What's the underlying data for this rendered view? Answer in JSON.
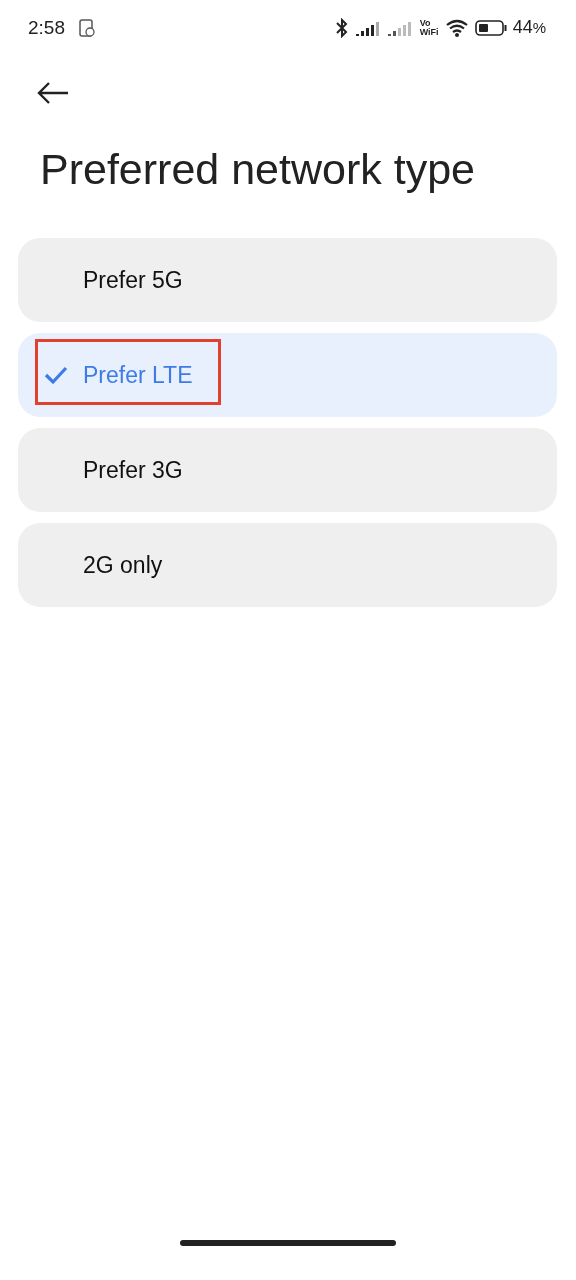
{
  "status_bar": {
    "time": "2:58",
    "battery_percent": "44",
    "percent_sign": "%",
    "vowifi": [
      "Vo",
      "WiFi"
    ]
  },
  "title": "Preferred network type",
  "options": [
    {
      "label": "Prefer 5G",
      "selected": false,
      "highlighted": false
    },
    {
      "label": "Prefer LTE",
      "selected": true,
      "highlighted": true
    },
    {
      "label": "Prefer 3G",
      "selected": false,
      "highlighted": false
    },
    {
      "label": "2G only",
      "selected": false,
      "highlighted": false
    }
  ]
}
